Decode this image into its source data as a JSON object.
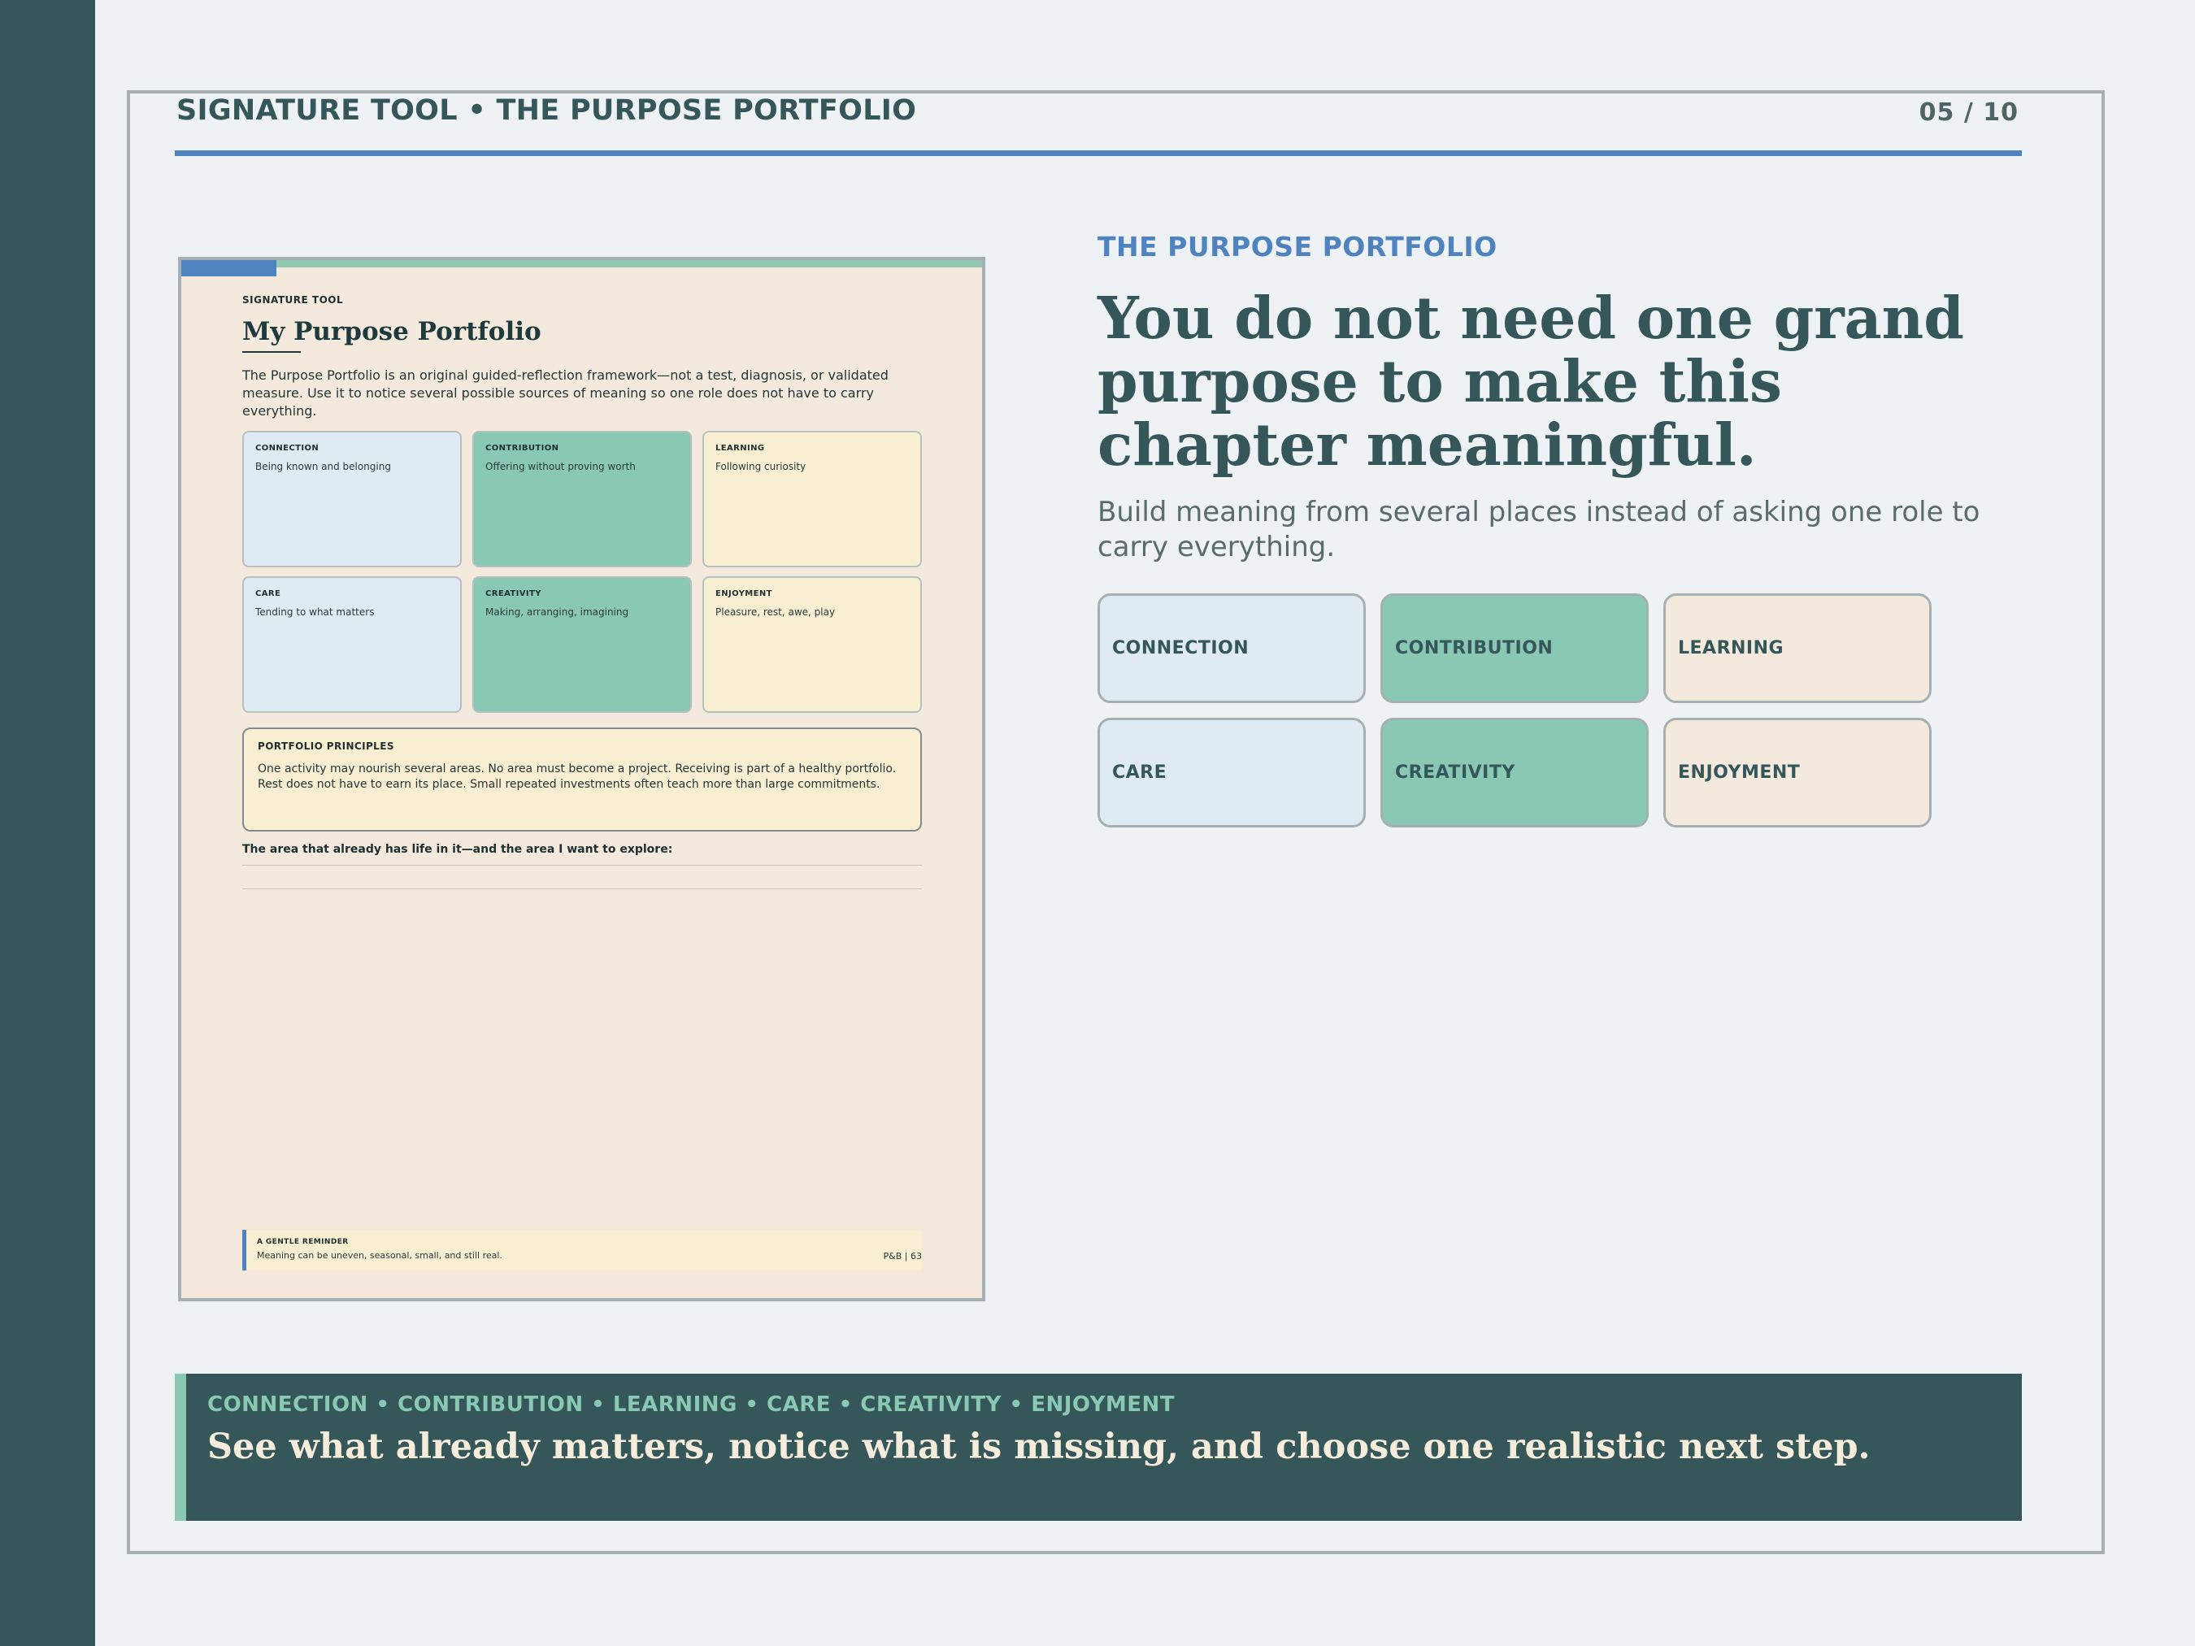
{
  "header": {
    "title": "SIGNATURE TOOL • THE PURPOSE PORTFOLIO",
    "page_indicator": "05 / 10"
  },
  "worksheet": {
    "kicker": "SIGNATURE TOOL",
    "title": "My Purpose Portfolio",
    "intro": "The Purpose Portfolio is an original guided-reflection framework—not a test, diagnosis, or validated measure. Use it to notice several possible sources of meaning so one role does not have to carry everything.",
    "cards": [
      {
        "title": "CONNECTION",
        "desc": "Being known and belonging"
      },
      {
        "title": "CONTRIBUTION",
        "desc": "Offering without proving worth"
      },
      {
        "title": "LEARNING",
        "desc": "Following curiosity"
      },
      {
        "title": "CARE",
        "desc": "Tending to what matters"
      },
      {
        "title": "CREATIVITY",
        "desc": "Making, arranging, imagining"
      },
      {
        "title": "ENJOYMENT",
        "desc": "Pleasure, rest, awe, play"
      }
    ],
    "principles": {
      "title": "PORTFOLIO PRINCIPLES",
      "body": "One activity may nourish several areas. No area must become a project. Receiving is part of a healthy portfolio. Rest does not have to earn its place. Small repeated investments often teach more than large commitments."
    },
    "prompt": "The area that already has life in it—and the area I want to explore:",
    "reminder": {
      "title": "A GENTLE REMINDER",
      "body": "Meaning can be uneven, seasonal, small, and still real.",
      "page": "P&B  |  63"
    }
  },
  "main": {
    "kicker": "THE PURPOSE PORTFOLIO",
    "headline": "You do not need one grand purpose to make this chapter meaningful.",
    "subhead": "Build meaning from several places instead of asking one role to carry everything.",
    "areas": [
      "CONNECTION",
      "CONTRIBUTION",
      "LEARNING",
      "CARE",
      "CREATIVITY",
      "ENJOYMENT"
    ]
  },
  "banner": {
    "kicker": "CONNECTION • CONTRIBUTION • LEARNING • CARE • CREATIVITY • ENJOYMENT",
    "text": "See what already matters, notice what is missing, and choose one realistic next step."
  },
  "colors": {
    "sidebar": "#36575a",
    "accent_blue": "#4e83c0",
    "mint": "#89c8b3",
    "light_blue": "#dfeaf2",
    "cream": "#f3eadd"
  }
}
